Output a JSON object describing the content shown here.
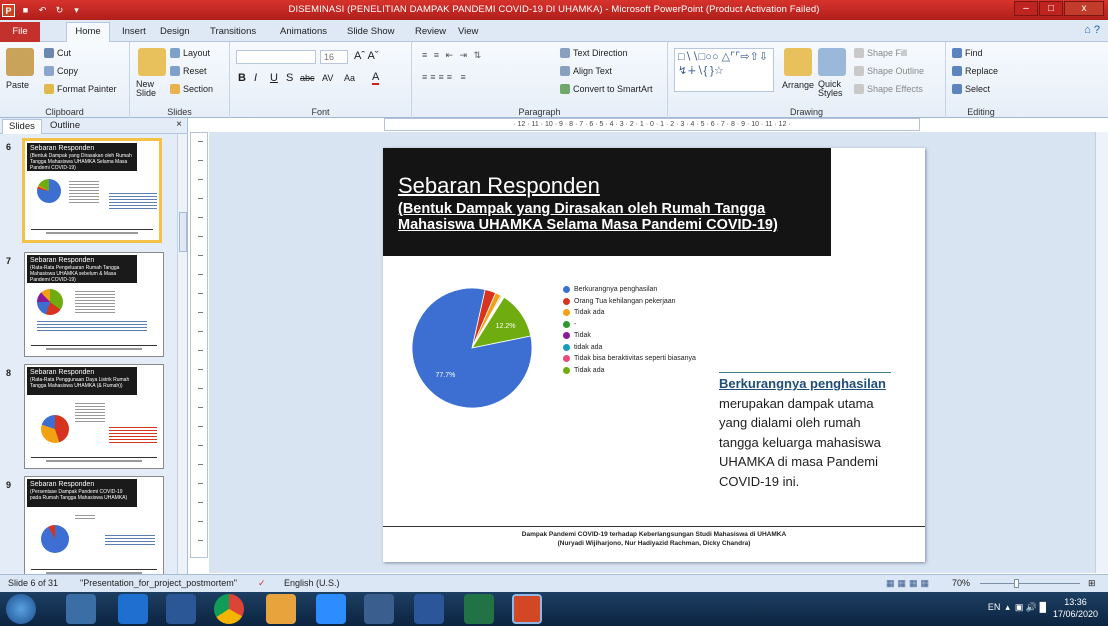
{
  "window": {
    "title": "DISEMINASI (PENELITIAN DAMPAK PANDEMI COVID-19 DI UHAMKA) - Microsoft PowerPoint (Product Activation Failed)",
    "min": "–",
    "max": "□",
    "close": "x"
  },
  "tabs": [
    "File",
    "Home",
    "Insert",
    "Design",
    "Transitions",
    "Animations",
    "Slide Show",
    "Review",
    "View"
  ],
  "help": "⌂ ?",
  "ribbon": {
    "clipboard": {
      "label": "Clipboard",
      "paste": "Paste",
      "cut": "Cut",
      "copy": "Copy",
      "format_painter": "Format Painter"
    },
    "slides": {
      "label": "Slides",
      "new_slide": "New Slide",
      "layout": "Layout",
      "reset": "Reset",
      "section": "Section"
    },
    "font": {
      "label": "Font",
      "size": "16",
      "bold": "B",
      "italic": "I",
      "underline": "U",
      "shadow": "S",
      "strike": "abc",
      "spacing": "AV",
      "case": "Aa",
      "color": "A"
    },
    "paragraph": {
      "label": "Paragraph",
      "text_direction": "Text Direction",
      "align_text": "Align Text",
      "smartart": "Convert to SmartArt"
    },
    "drawing": {
      "label": "Drawing",
      "arrange": "Arrange",
      "quick_styles": "Quick Styles",
      "shape_fill": "Shape Fill",
      "shape_outline": "Shape Outline",
      "shape_effects": "Shape Effects"
    },
    "editing": {
      "label": "Editing",
      "find": "Find",
      "replace": "Replace",
      "select": "Select"
    }
  },
  "panel": {
    "tab_slides": "Slides",
    "tab_outline": "Outline",
    "close": "×"
  },
  "thumbs": [
    {
      "num": "6",
      "title": "Sebaran Responden",
      "sub": "(Bentuk Dampak yang Dirasakan oleh Rumah Tangga Mahasiswa UHAMKA Selama Masa Pandemi COVID-19)"
    },
    {
      "num": "7",
      "title": "Sebaran Responden",
      "sub": "(Rata-Rata Pengeluaran Rumah Tangga Mahasiswa UHAMKA sebelum & Masa Pandemi COVID-19)"
    },
    {
      "num": "8",
      "title": "Sebaran Responden",
      "sub": "(Rata-Rata Penggunaan Daya Listrik Rumah Tangga Mahasiswa UHAMKA (& Rumah))"
    },
    {
      "num": "9",
      "title": "Sebaran Responden",
      "sub": "(Persentase Dampak Pandemi COVID-19 pada Rumah Tangga Mahasiswa UHAMKA)"
    }
  ],
  "ruler": "· 12 · 11 · 10 · 9 · 8 · 7 · 6 · 5 · 4 · 3 · 2 · 1 · 0 · 1 · 2 · 3 · 4 · 5 · 6 · 7 · 8 · 9 · 10 · 11 · 12 ·",
  "slide": {
    "title": "Sebaran Responden",
    "subtitle": "(Bentuk Dampak yang Dirasakan oleh Rumah Tangga Mahasiswa UHAMKA Selama Masa Pandemi COVID-19)",
    "note_highlight": "Berkurangnya penghasilan",
    "note_rest": "merupakan dampak utama yang dialami oleh rumah tangga keluarga mahasiswa UHAMKA di masa Pandemi COVID-19 ini.",
    "footer1": "Dampak Pandemi COVID-19 terhadap Keberlangsungan Studi Mahasiswa di UHAMKA",
    "footer2": "(Nuryadi Wijiharjono, Nur Hadiyazid Rachman, Dicky Chandra)"
  },
  "chart_data": {
    "type": "pie",
    "categories": [
      "Berkurangnya penghasilan",
      "Orang Tua kehilangan pekerjaan",
      "Tidak ada",
      "-",
      "Tidak",
      "tidak ada",
      "Tidak bisa beraktivitas seperti biasanya",
      "Tidak ada"
    ],
    "values": [
      77.7,
      2.8,
      1.5,
      0.3,
      0.2,
      0.2,
      0.2,
      12.2
    ],
    "labels_shown": [
      "77.7%",
      "",
      "",
      "",
      "",
      "",
      "",
      "12.2%"
    ],
    "colors": [
      "#3c6fd1",
      "#d6341f",
      "#f2a014",
      "#2a9a2a",
      "#8b1a9b",
      "#1a9bbd",
      "#e84a7a",
      "#6fac10"
    ],
    "legend_position": "right"
  },
  "status": {
    "slide": "Slide 6 of 31",
    "theme": "\"Presentation_for_project_postmortem\"",
    "lang": "English (U.S.)",
    "zoom": "70%"
  },
  "taskbar": {
    "lang": "EN",
    "time": "13:36",
    "date": "17/06/2020"
  }
}
